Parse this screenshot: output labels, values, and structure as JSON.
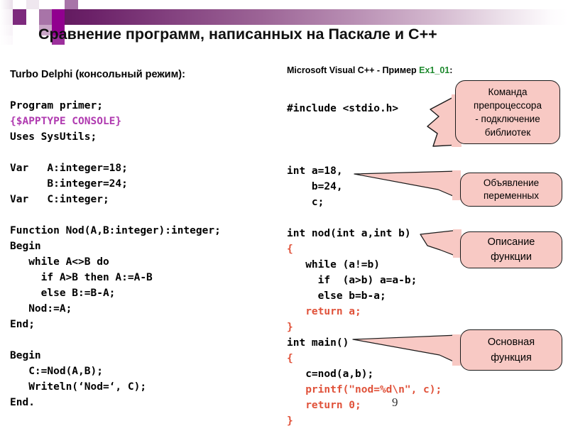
{
  "slide": {
    "title": "Сравнение программ, написанных на Паскале и С++",
    "page_number": "9",
    "accent_color": "#6b2168",
    "callout_fill": "#f8c9c4",
    "callout_border": "#1a1a1a"
  },
  "left_column": {
    "heading": "Turbo Delphi (консольный режим):",
    "lines": [
      {
        "text": "Program primer;",
        "color": "black"
      },
      {
        "text": "{$APPTYPE CONSOLE}",
        "color": "violet"
      },
      {
        "text": "Uses SysUtils;",
        "color": "black"
      },
      {
        "text": "",
        "color": "black"
      },
      {
        "text": "Var   A:integer=18;",
        "color": "black"
      },
      {
        "text": "      B:integer=24;",
        "color": "black"
      },
      {
        "text": "Var   C:integer;",
        "color": "black"
      },
      {
        "text": "",
        "color": "black"
      },
      {
        "text": "Function Nod(A,B:integer):integer;",
        "color": "black"
      },
      {
        "text": "Begin",
        "color": "black"
      },
      {
        "text": "   while A<>B do",
        "color": "black"
      },
      {
        "text": "     if A>B then A:=A-B",
        "color": "black"
      },
      {
        "text": "     else B:=B-A;",
        "color": "black"
      },
      {
        "text": "   Nod:=A;",
        "color": "black"
      },
      {
        "text": "End;",
        "color": "black"
      },
      {
        "text": "",
        "color": "black"
      },
      {
        "text": "Begin",
        "color": "black"
      },
      {
        "text": "   C:=Nod(A,B);",
        "color": "black"
      },
      {
        "text": "   Writeln(‘Nod=‘, C);",
        "color": "black"
      },
      {
        "text": "End.",
        "color": "black"
      }
    ]
  },
  "right_column": {
    "heading_prefix": "Microsoft Visual C++ - Пример ",
    "heading_example": "Ex1_01",
    "heading_suffix": ":",
    "lines": [
      {
        "text": "#include <stdio.h>",
        "color": "black"
      },
      {
        "text": "",
        "color": "black"
      },
      {
        "text": "",
        "color": "black"
      },
      {
        "text": "",
        "color": "black"
      },
      {
        "text": "int a=18,",
        "color": "black"
      },
      {
        "text": "    b=24,",
        "color": "black"
      },
      {
        "text": "    c;",
        "color": "black"
      },
      {
        "text": "",
        "color": "black"
      },
      {
        "text": "int nod(int a,int b)",
        "color": "black"
      },
      {
        "text": "{",
        "color": "red"
      },
      {
        "text": "   while (a!=b)",
        "color": "black"
      },
      {
        "text": "     if  (a>b) a=a-b;",
        "color": "black"
      },
      {
        "text": "     else b=b-a;",
        "color": "black"
      },
      {
        "text": "   return a;",
        "color": "red"
      },
      {
        "text": "}",
        "color": "red"
      },
      {
        "text": "int main()",
        "color": "black"
      },
      {
        "text": "{",
        "color": "red"
      },
      {
        "text": "   c=nod(a,b);",
        "color": "black"
      },
      {
        "text": "   printf(\"nod=%d\\n\", c);",
        "color": "red"
      },
      {
        "text": "   return 0;",
        "color": "red"
      },
      {
        "text": "}",
        "color": "red"
      }
    ]
  },
  "callouts": [
    {
      "name": "preprocessor",
      "lines": [
        "Команда",
        "препроцессора",
        "- подключение",
        "библиотек"
      ]
    },
    {
      "name": "variables",
      "lines": [
        "Объявление",
        "переменных"
      ]
    },
    {
      "name": "function",
      "lines": [
        "Описание",
        "функции"
      ]
    },
    {
      "name": "main",
      "lines": [
        "Основная",
        "функция"
      ]
    }
  ]
}
